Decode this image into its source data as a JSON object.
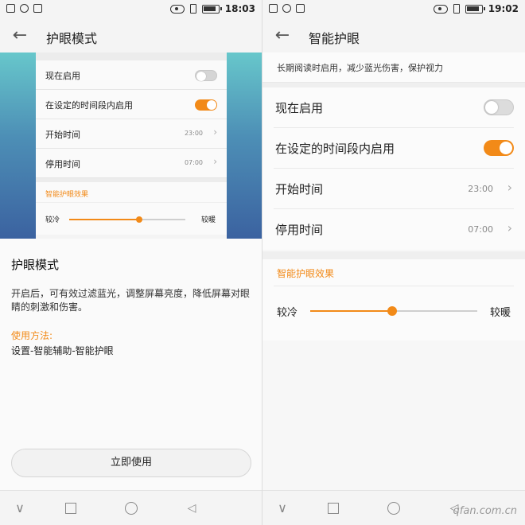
{
  "left": {
    "status_bar": {
      "time": "18:03"
    },
    "title": "护眼模式",
    "preview": {
      "rows": [
        {
          "label": "现在启用",
          "type": "toggle",
          "state": "off"
        },
        {
          "label": "在设定的时间段内启用",
          "type": "toggle",
          "state": "on"
        },
        {
          "label": "开始时间",
          "type": "value",
          "value": "23:00"
        },
        {
          "label": "停用时间",
          "type": "value",
          "value": "07:00"
        }
      ],
      "effect_title": "智能护眼效果",
      "slider": {
        "left_label": "较冷",
        "right_label": "较暖",
        "level": 0.6
      }
    },
    "description": {
      "heading": "护眼模式",
      "body": "开启后，可有效过滤蓝光，调整屏幕亮度，降低屏幕对眼睛的刺激和伤害。",
      "usage_title": "使用方法:",
      "usage_path": "设置-智能辅助-智能护眼"
    },
    "use_button": "立即使用"
  },
  "right": {
    "status_bar": {
      "time": "19:02"
    },
    "title": "智能护眼",
    "info": "长期阅读时启用，减少蓝光伤害，保护视力",
    "rows": [
      {
        "label": "现在启用",
        "type": "toggle",
        "state": "off"
      },
      {
        "label": "在设定的时间段内启用",
        "type": "toggle",
        "state": "on"
      },
      {
        "label": "开始时间",
        "type": "value",
        "value": "23:00"
      },
      {
        "label": "停用时间",
        "type": "value",
        "value": "07:00"
      }
    ],
    "effect_title": "智能护眼效果",
    "slider": {
      "left_label": "较冷",
      "right_label": "较暖",
      "level": 0.49
    }
  },
  "watermark": "qfan.com.cn",
  "colors": {
    "accent": "#f28a18",
    "toggle_off": "#dcdcdc"
  },
  "icons": {
    "nav": [
      "chevron-down-icon",
      "recents-square-icon",
      "home-circle-icon",
      "back-triangle-icon"
    ],
    "back": "arrow-left-icon"
  }
}
